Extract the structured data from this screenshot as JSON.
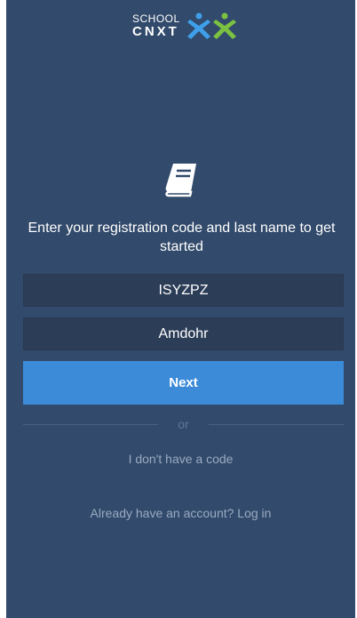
{
  "brand": {
    "school": "SCHOOL",
    "cnxt": "CNXT",
    "colors": {
      "blue": "#3ea0ea",
      "green": "#7cc242"
    }
  },
  "icons": {
    "logo_mark": "people-x-icon",
    "book": "book-icon"
  },
  "headline": "Enter your registration code and last name to get started",
  "form": {
    "code_value": "ISYZPZ",
    "name_value": "Amdohr",
    "next_label": "Next"
  },
  "divider_text": "or",
  "no_code_link": "I don't have a code",
  "login_link": "Already have an account? Log in",
  "colors": {
    "background": "#324a6b",
    "input_bg": "#2b3d57",
    "button": "#3c8bd9",
    "link": "#9aabc2"
  }
}
